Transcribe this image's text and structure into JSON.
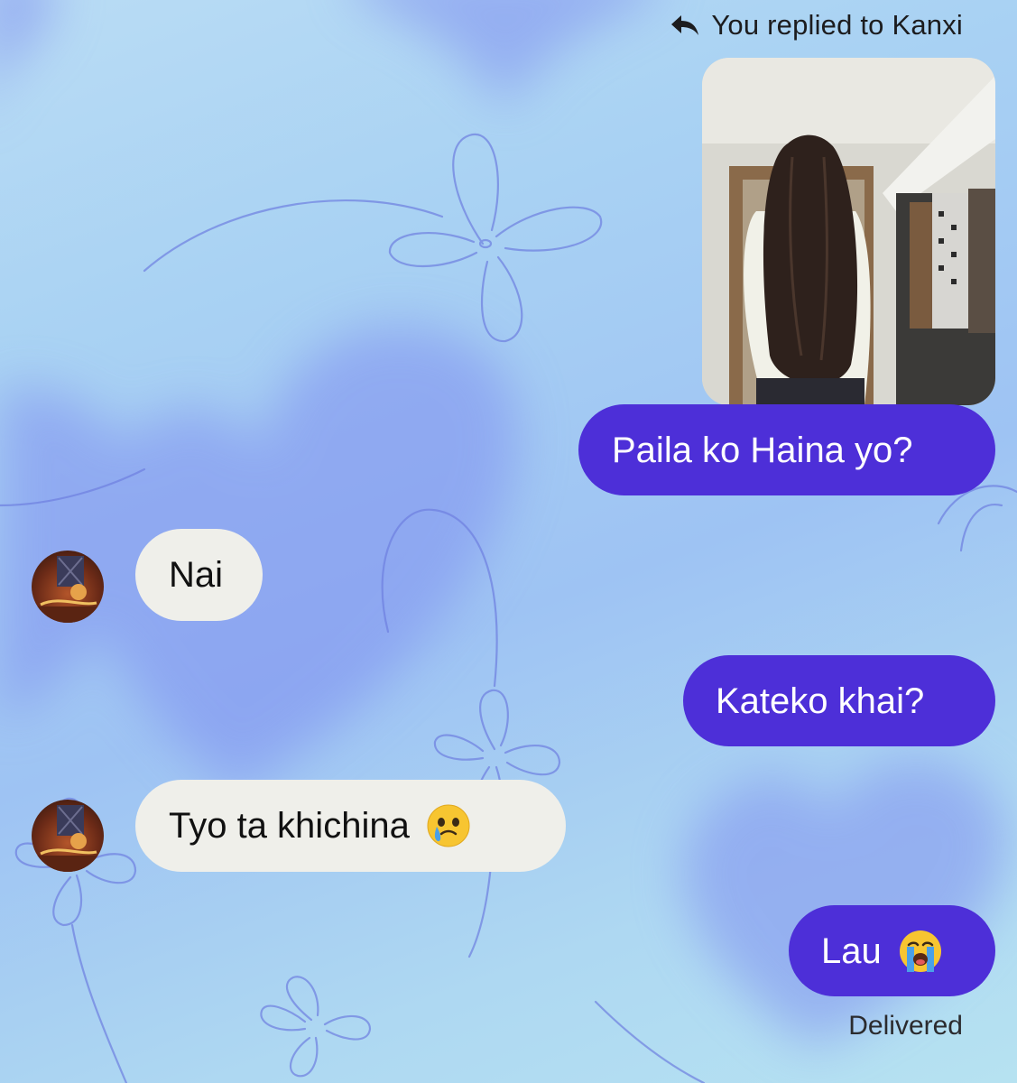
{
  "reply_header": {
    "icon": "reply-arrow-icon",
    "text": "You replied to Kanxi"
  },
  "photo": {
    "description_icon": "photo-thumbnail"
  },
  "messages": [
    {
      "side": "out",
      "text": "Paila ko Haina yo?"
    },
    {
      "side": "in",
      "text": "Nai",
      "avatar": "contact-avatar"
    },
    {
      "side": "out",
      "text": "Kateko khai?"
    },
    {
      "side": "in",
      "text": "Tyo ta khichina",
      "emoji": "face-holding-back-tears-emoji",
      "avatar": "contact-avatar"
    },
    {
      "side": "out",
      "text": "Lau",
      "emoji": "loudly-crying-face-emoji"
    }
  ],
  "status": {
    "delivered": "Delivered"
  },
  "colors": {
    "outgoing_bubble": "#4d2fd8",
    "incoming_bubble": "#efefea",
    "background_start": "#b9dcf4",
    "background_end": "#9ec3f3"
  }
}
